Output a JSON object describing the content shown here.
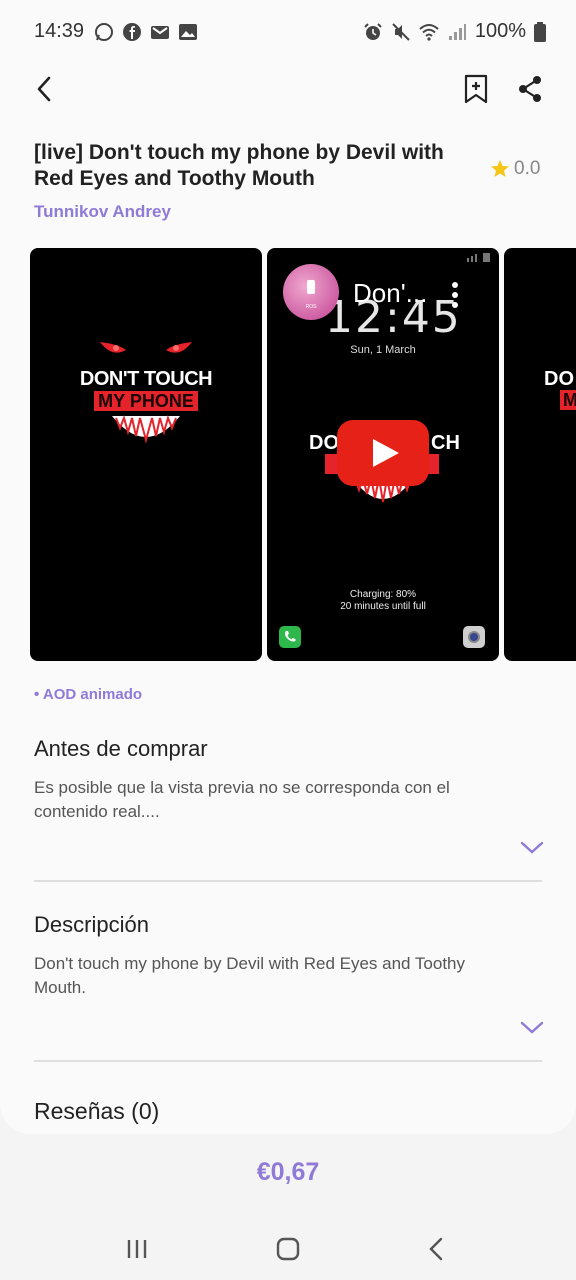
{
  "status_bar": {
    "time": "14:39",
    "battery": "100%",
    "left_icons": [
      "whatsapp-icon",
      "facebook-icon",
      "gmail-icon",
      "gallery-icon"
    ],
    "right_icons": [
      "alarm-icon",
      "mute-icon",
      "wifi-icon",
      "signal-icon",
      "battery-icon"
    ]
  },
  "header": {
    "back_icon": "back-arrow-icon",
    "bookmark_icon": "bookmark-add-icon",
    "share_icon": "share-icon"
  },
  "product": {
    "title": "[live] Don't touch my phone by Devil with Red Eyes and Toothy Mouth",
    "rating": "0.0",
    "author": "Tunnikov Andrey",
    "tag": "• AOD animado"
  },
  "previews": {
    "shot1_line1": "DON'T TOUCH",
    "shot1_line2": "MY PHONE",
    "shot2_overlay_title": "Don'...",
    "shot2_clock": "12:45",
    "shot2_date": "Sun, 1 March",
    "shot2_partial_left": "DO",
    "shot2_partial_right": "CH",
    "shot2_charging": "Charging: 80%",
    "shot2_until_full": "20 minutes until full",
    "shot2_badge": "ROS",
    "shot3_partial_1": "DO",
    "shot3_partial_2": "M"
  },
  "sections": {
    "before_buy_title": "Antes de comprar",
    "before_buy_text": "Es posible que la vista previa no se corresponda con el contenido real....",
    "description_title": "Descripción",
    "description_text": "Don't touch my phone by Devil with Red Eyes and Toothy Mouth.",
    "reviews_title": "Reseñas (0)"
  },
  "purchase": {
    "price": "€0,67"
  },
  "colors": {
    "accent": "#8f7ad8",
    "star": "#f5c518",
    "youtube_red": "#e62117",
    "devil_red": "#e5232a"
  }
}
